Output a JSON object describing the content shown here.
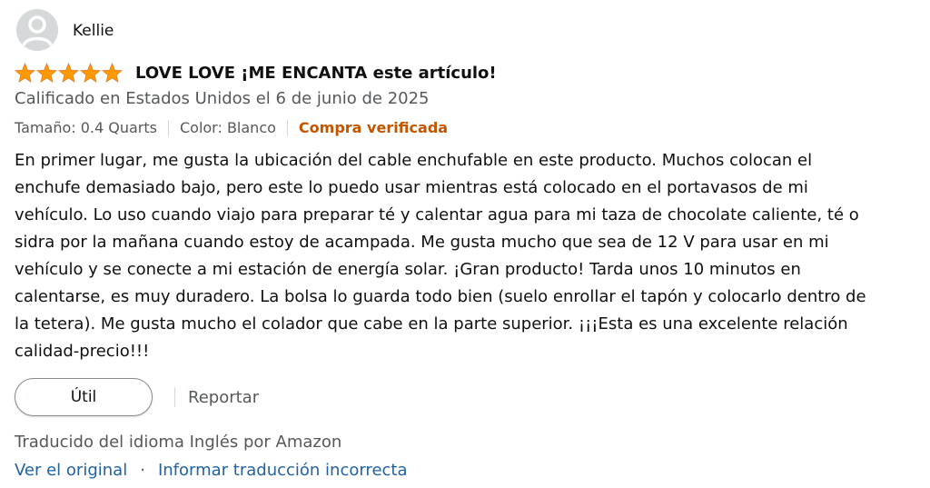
{
  "reviewer": {
    "name": "Kellie",
    "avatar_icon": "user-silhouette-icon"
  },
  "rating": {
    "stars": 5,
    "max": 5,
    "star_color": "#ff9900"
  },
  "review": {
    "title": "LOVE LOVE ¡ME ENCANTA este artículo!",
    "date": "Calificado en Estados Unidos el 6 de junio de 2025",
    "size": "Tamaño: 0.4 Quarts",
    "color": "Color: Blanco",
    "verified": "Compra verificada",
    "body": [
      "En primer lugar, me gusta la ubicación del cable enchufable en este producto. Muchos colocan el",
      "enchufe demasiado bajo, pero este lo puedo usar mientras está colocado en el portavasos de mi",
      "vehículo. Lo uso cuando viajo para preparar té y calentar agua para mi taza de chocolate caliente, té o",
      "sidra por la mañana cuando estoy de acampada. Me gusta mucho que sea de 12 V para usar en mi",
      "vehículo y se conecte a mi estación de energía solar. ¡Gran producto! Tarda unos 10 minutos en",
      "calentarse, es muy duradero. La bolsa lo guarda todo bien (suelo enrollar el tapón y colocarlo dentro de",
      "la tetera). Me gusta mucho el colador que cabe en la parte superior. ¡¡¡Esta es una excelente relación",
      "calidad-precio!!!"
    ]
  },
  "actions": {
    "helpful_label": "Útil",
    "report_label": "Reportar"
  },
  "translation": {
    "note": "Traducido del idioma Inglés por Amazon",
    "view_original": "Ver el original",
    "separator": "·",
    "report_translation": "Informar traducción incorrecta"
  }
}
